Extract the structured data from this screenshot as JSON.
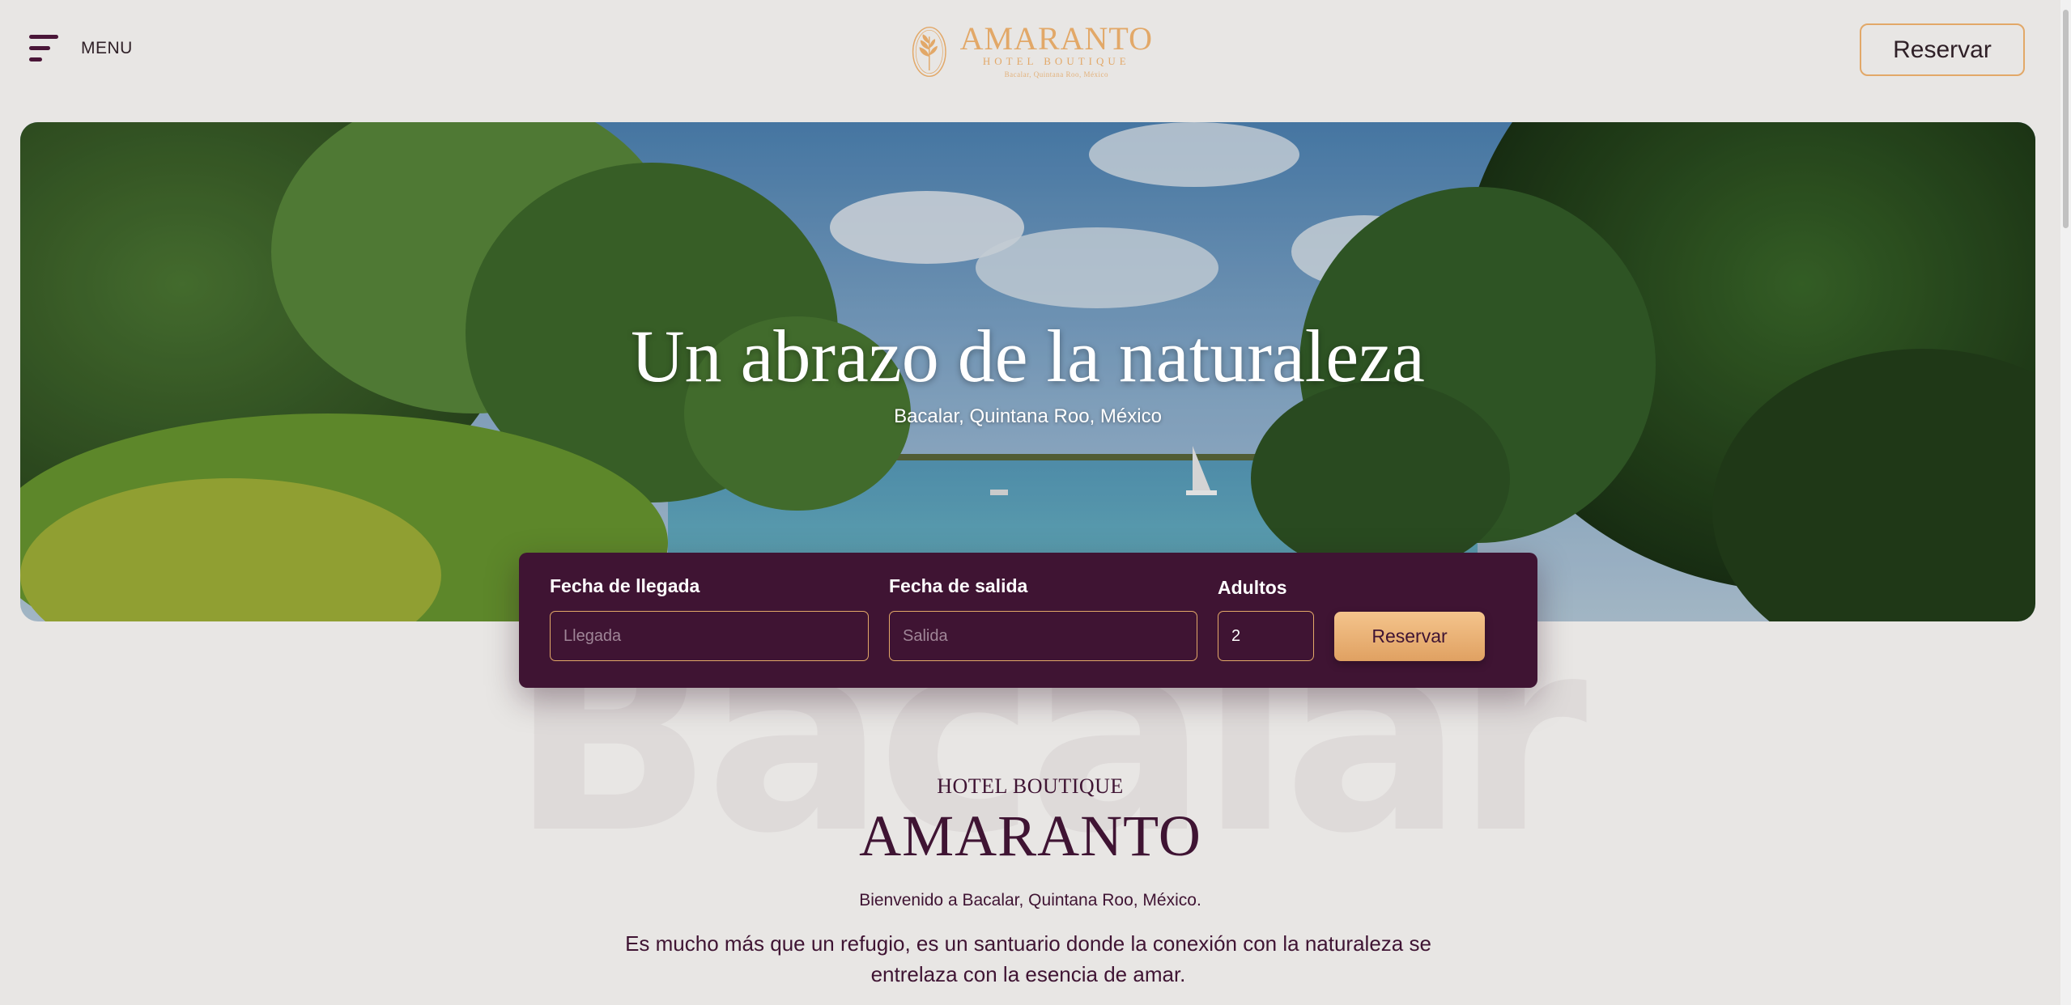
{
  "header": {
    "menu_label": "MENU",
    "logo": {
      "name": "AMARANTO",
      "subtitle": "HOTEL BOUTIQUE",
      "location": "Bacalar, Quintana Roo, México"
    },
    "reserve_label": "Reservar"
  },
  "hero": {
    "title": "Un abrazo de la naturaleza",
    "subtitle": "Bacalar, Quintana Roo, México"
  },
  "booking": {
    "arrival_label": "Fecha de llegada",
    "arrival_placeholder": "Llegada",
    "departure_label": "Fecha de salida",
    "departure_placeholder": "Salida",
    "adults_label": "Adultos",
    "adults_value": "2",
    "submit_label": "Reservar"
  },
  "intro": {
    "watermark": "Bacalar",
    "kicker": "HOTEL BOUTIQUE",
    "title": "AMARANTO",
    "welcome": "Bienvenido a Bacalar, Quintana Roo, México.",
    "body": "Es mucho más que un refugio, es un santuario donde la conexión con la naturaleza se entrelaza con la esencia de amar."
  },
  "colors": {
    "brand": "#3f1433",
    "accent": "#e2a868",
    "background": "#e8e6e4"
  }
}
